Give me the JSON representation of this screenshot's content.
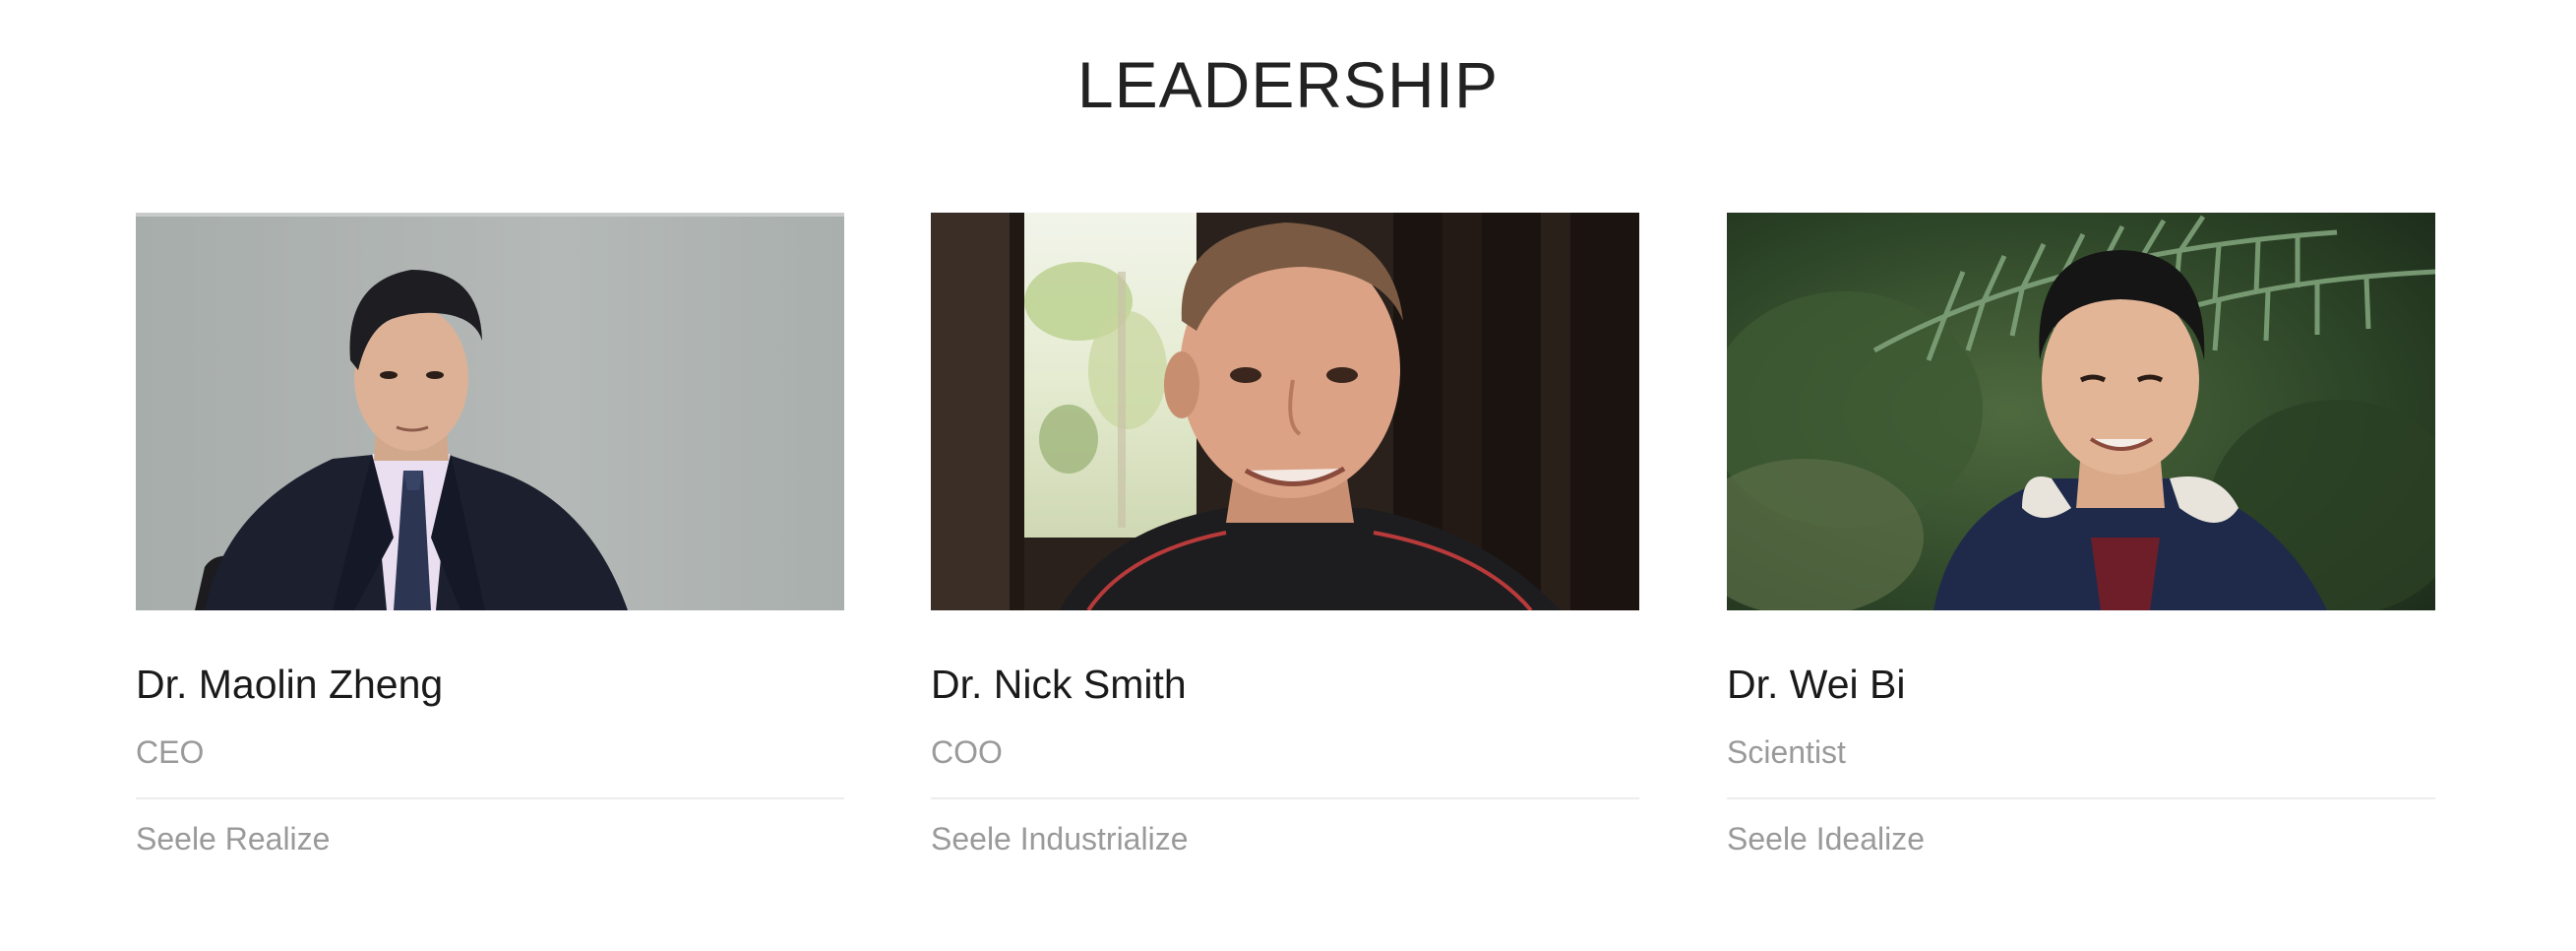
{
  "section": {
    "title": "LEADERSHIP"
  },
  "leaders": [
    {
      "name": "Dr. Maolin Zheng",
      "role": "CEO",
      "company": "Seele Realize",
      "photo_background": "#aeb3b1"
    },
    {
      "name": "Dr. Nick Smith",
      "role": "COO",
      "company": "Seele Industrialize",
      "photo_background": "#2a211c"
    },
    {
      "name": "Dr. Wei Bi",
      "role": "Scientist",
      "company": "Seele Idealize",
      "photo_background": "#2f4a2a"
    }
  ],
  "colors": {
    "title": "#222222",
    "name": "#1a1a1a",
    "muted": "#9a9a9a",
    "divider": "#ececec"
  }
}
